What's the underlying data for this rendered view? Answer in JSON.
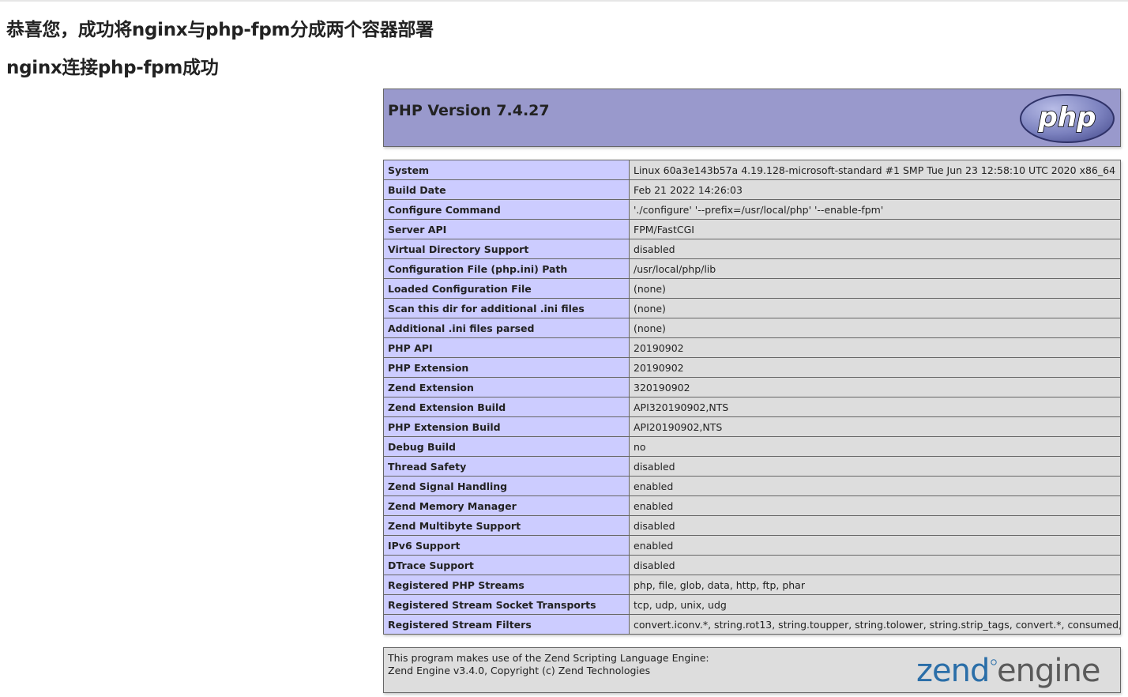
{
  "page": {
    "heading_1": "恭喜您，成功将nginx与php-fpm分成两个容器部署",
    "heading_2": "nginx连接php-fpm成功"
  },
  "phpinfo": {
    "version_title": "PHP Version 7.4.27",
    "logo_text": "php",
    "rows": [
      {
        "key": "System",
        "value": "Linux 60a3e143b57a 4.19.128-microsoft-standard #1 SMP Tue Jun 23 12:58:10 UTC 2020 x86_64"
      },
      {
        "key": "Build Date",
        "value": "Feb 21 2022 14:26:03"
      },
      {
        "key": "Configure Command",
        "value": "'./configure' '--prefix=/usr/local/php' '--enable-fpm'"
      },
      {
        "key": "Server API",
        "value": "FPM/FastCGI"
      },
      {
        "key": "Virtual Directory Support",
        "value": "disabled"
      },
      {
        "key": "Configuration File (php.ini) Path",
        "value": "/usr/local/php/lib"
      },
      {
        "key": "Loaded Configuration File",
        "value": "(none)"
      },
      {
        "key": "Scan this dir for additional .ini files",
        "value": "(none)"
      },
      {
        "key": "Additional .ini files parsed",
        "value": "(none)"
      },
      {
        "key": "PHP API",
        "value": "20190902"
      },
      {
        "key": "PHP Extension",
        "value": "20190902"
      },
      {
        "key": "Zend Extension",
        "value": "320190902"
      },
      {
        "key": "Zend Extension Build",
        "value": "API320190902,NTS"
      },
      {
        "key": "PHP Extension Build",
        "value": "API20190902,NTS"
      },
      {
        "key": "Debug Build",
        "value": "no"
      },
      {
        "key": "Thread Safety",
        "value": "disabled"
      },
      {
        "key": "Zend Signal Handling",
        "value": "enabled"
      },
      {
        "key": "Zend Memory Manager",
        "value": "enabled"
      },
      {
        "key": "Zend Multibyte Support",
        "value": "disabled"
      },
      {
        "key": "IPv6 Support",
        "value": "enabled"
      },
      {
        "key": "DTrace Support",
        "value": "disabled"
      },
      {
        "key": "Registered PHP Streams",
        "value": "php, file, glob, data, http, ftp, phar"
      },
      {
        "key": "Registered Stream Socket Transports",
        "value": "tcp, udp, unix, udg"
      },
      {
        "key": "Registered Stream Filters",
        "value": "convert.iconv.*, string.rot13, string.toupper, string.tolower, string.strip_tags, convert.*, consumed, dechunk"
      }
    ],
    "zend": {
      "line_1": "This program makes use of the Zend Scripting Language Engine:",
      "line_2": "Zend Engine v3.4.0, Copyright (c) Zend Technologies",
      "logo_word_1": "zend",
      "logo_word_2": "engine"
    }
  },
  "colors": {
    "header_bg": "#9999cc",
    "key_cell_bg": "#ccccff",
    "value_cell_bg": "#dddddd",
    "zend_logo_blue": "#2a6ea8"
  }
}
